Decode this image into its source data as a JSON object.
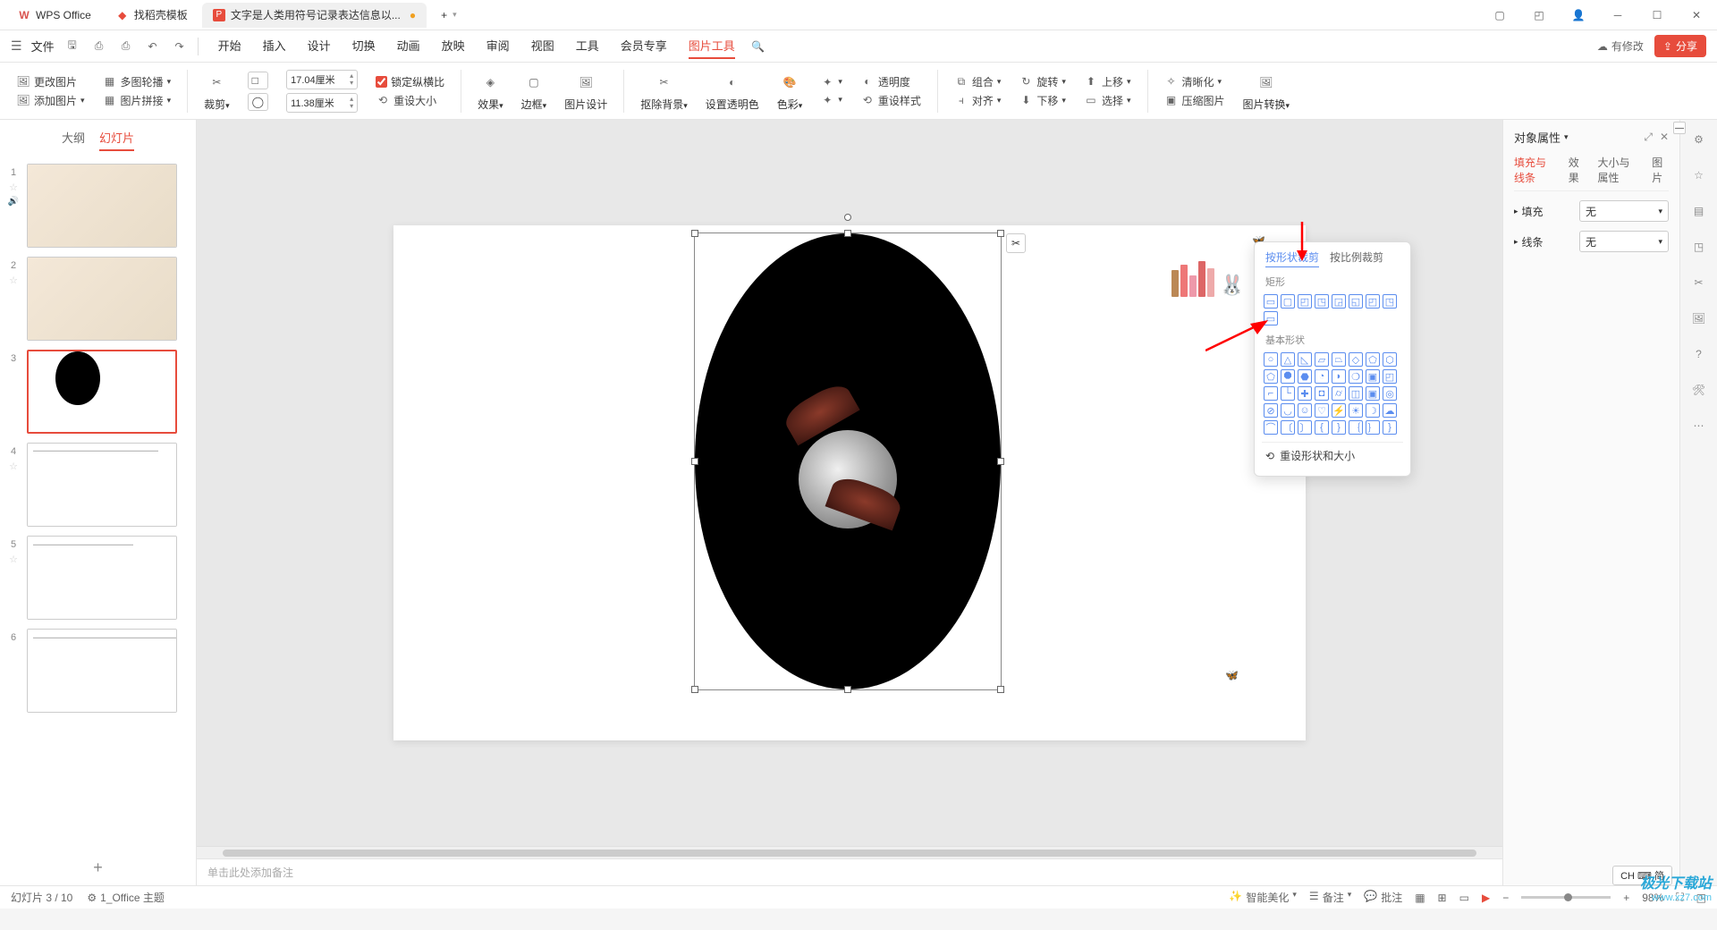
{
  "title_bar": {
    "app_name": "WPS Office",
    "tab2": "找稻壳模板",
    "tab3_prefix": "P",
    "tab3": "文字是人类用符号记录表达信息以...",
    "add_tab": "+"
  },
  "menu_bar": {
    "file": "文件",
    "tabs": [
      "开始",
      "插入",
      "设计",
      "切换",
      "动画",
      "放映",
      "审阅",
      "视图",
      "工具",
      "会员专享",
      "图片工具"
    ],
    "active_tab": "图片工具",
    "cloud": "有修改",
    "share_icon": "⇪",
    "share": "分享"
  },
  "ribbon": {
    "change_picture": "更改图片",
    "add_picture": "添加图片",
    "multi_crop": "多图轮播",
    "pic_collage": "图片拼接",
    "crop": "裁剪",
    "crop_icon_square": "□",
    "width": "17.04厘米",
    "height": "11.38厘米",
    "lock_ratio": "锁定纵横比",
    "reset_size": "重设大小",
    "effect": "效果",
    "border": "边框",
    "pic_design": "图片设计",
    "remove_bg": "抠除背景",
    "set_transparent": "设置透明色",
    "color": "色彩",
    "sparkle1": "✦",
    "sparkle2": "✦",
    "transparency": "透明度",
    "reset_style": "重设样式",
    "combine": "组合",
    "rotate": "旋转",
    "align": "对齐",
    "move_up": "上移",
    "move_down": "下移",
    "select": "选择",
    "clarity": "清晰化",
    "compress": "压缩图片",
    "pic_convert": "图片转换"
  },
  "outline": {
    "tab_outline": "大纲",
    "tab_slides": "幻灯片",
    "slides": [
      1,
      2,
      3,
      4,
      5,
      6
    ],
    "selected": 3,
    "add": "+"
  },
  "crop_popup": {
    "tab_shape": "按形状裁剪",
    "tab_ratio": "按比例裁剪",
    "section_rect": "矩形",
    "section_basic": "基本形状",
    "reset": "重设形状和大小"
  },
  "prop_panel": {
    "title": "对象属性",
    "tabs": [
      "填充与线条",
      "效果",
      "大小与属性",
      "图片"
    ],
    "fill_label": "填充",
    "fill_value": "无",
    "line_label": "线条",
    "line_value": "无"
  },
  "notes": {
    "placeholder": "单击此处添加备注"
  },
  "status_bar": {
    "slide_info": "幻灯片 3 / 10",
    "theme": "1_Office 主题",
    "beautify": "智能美化",
    "notes": "备注",
    "comments": "批注",
    "zoom": "98%",
    "plus": "+",
    "minus": "−"
  },
  "ime": "CH ⌨ 简",
  "watermark": {
    "brand": "极光下载站",
    "url": "www.xz7.com"
  }
}
